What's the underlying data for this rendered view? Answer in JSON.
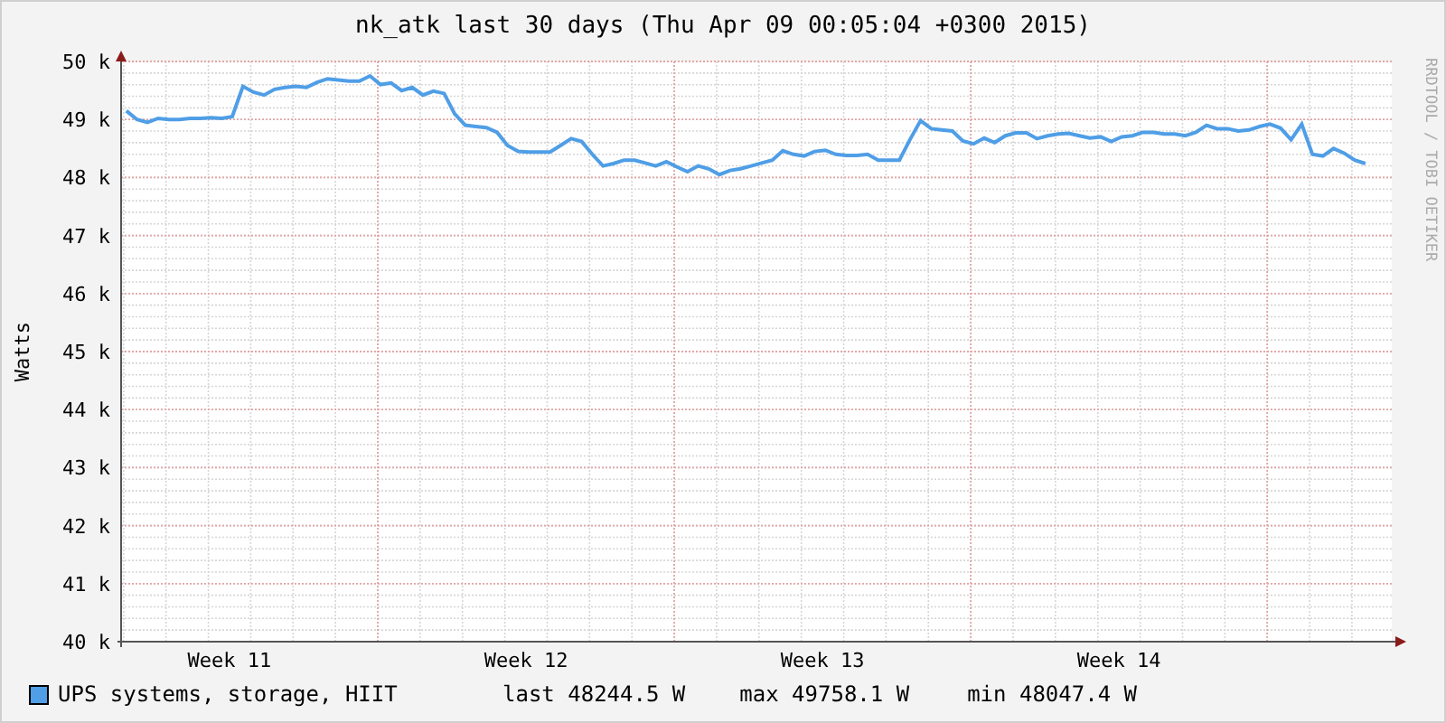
{
  "title": "nk_atk last 30 days (Thu Apr 09 00:05:04 +0300 2015)",
  "credit": "RRDTOOL / TOBI OETIKER",
  "chart_data": {
    "type": "line",
    "grid": true,
    "ylabel": "Watts",
    "ylim": [
      40000,
      50000
    ],
    "yticks": [
      {
        "value": 40000,
        "label": "40 k"
      },
      {
        "value": 41000,
        "label": "41 k"
      },
      {
        "value": 42000,
        "label": "42 k"
      },
      {
        "value": 43000,
        "label": "43 k"
      },
      {
        "value": 44000,
        "label": "44 k"
      },
      {
        "value": 45000,
        "label": "45 k"
      },
      {
        "value": 46000,
        "label": "46 k"
      },
      {
        "value": 47000,
        "label": "47 k"
      },
      {
        "value": 48000,
        "label": "48 k"
      },
      {
        "value": 49000,
        "label": "49 k"
      },
      {
        "value": 50000,
        "label": "50 k"
      }
    ],
    "categories": [
      null,
      null,
      null,
      null,
      null,
      null,
      null,
      null,
      null,
      null,
      "Week 11",
      null,
      null,
      null,
      null,
      null,
      null,
      null,
      null,
      null,
      null,
      null,
      null,
      null,
      null,
      null,
      null,
      null,
      null,
      null,
      null,
      null,
      null,
      null,
      null,
      null,
      null,
      null,
      "Week 12",
      null,
      null,
      null,
      null,
      null,
      null,
      null,
      null,
      null,
      null,
      null,
      null,
      null,
      null,
      null,
      null,
      null,
      null,
      null,
      null,
      null,
      null,
      null,
      null,
      null,
      null,
      null,
      "Week 13",
      null,
      null,
      null,
      null,
      null,
      null,
      null,
      null,
      null,
      null,
      null,
      null,
      null,
      null,
      null,
      null,
      null,
      null,
      null,
      null,
      null,
      null,
      null,
      null,
      null,
      null,
      null,
      "Week 14",
      null,
      null,
      null,
      null,
      null,
      null,
      null,
      null,
      null,
      null,
      null,
      null,
      null,
      null,
      null,
      null,
      null,
      null,
      null,
      null,
      null,
      null,
      null
    ],
    "series": [
      {
        "name": "UPS systems, storage, HIIT",
        "color": "#4f9ee6",
        "values": [
          49150,
          49000,
          48950,
          49020,
          49000,
          49000,
          49020,
          49020,
          49030,
          49020,
          49050,
          49570,
          49470,
          49420,
          49520,
          49550,
          49570,
          49550,
          49640,
          49700,
          49680,
          49660,
          49660,
          49750,
          49600,
          49630,
          49500,
          49550,
          49420,
          49490,
          49450,
          49100,
          48900,
          48880,
          48860,
          48780,
          48550,
          48450,
          48440,
          48440,
          48440,
          48550,
          48670,
          48620,
          48400,
          48200,
          48240,
          48300,
          48300,
          48250,
          48200,
          48270,
          48180,
          48100,
          48200,
          48150,
          48050,
          48120,
          48150,
          48200,
          48250,
          48300,
          48460,
          48400,
          48370,
          48450,
          48470,
          48400,
          48380,
          48380,
          48400,
          48300,
          48300,
          48300,
          48650,
          48980,
          48840,
          48820,
          48800,
          48630,
          48580,
          48680,
          48600,
          48720,
          48770,
          48770,
          48670,
          48720,
          48750,
          48760,
          48720,
          48680,
          48700,
          48620,
          48700,
          48720,
          48780,
          48780,
          48750,
          48750,
          48720,
          48780,
          48900,
          48840,
          48840,
          48800,
          48820,
          48880,
          48920,
          48850,
          48650,
          48920,
          48400,
          48370,
          48500,
          48420,
          48300,
          48240
        ]
      }
    ]
  },
  "legend": {
    "stats": [
      "last 48244.5 W",
      "max 49758.1 W",
      "min 48047.4 W"
    ]
  }
}
